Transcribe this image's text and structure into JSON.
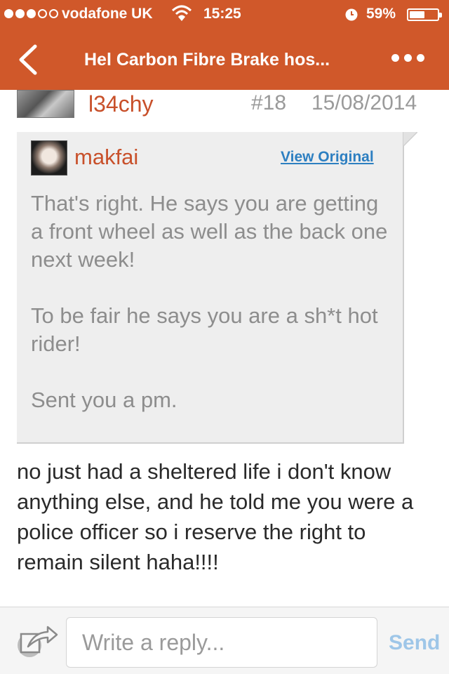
{
  "status_bar": {
    "carrier": "vodafone UK",
    "time": "15:25",
    "battery_percent": "59%",
    "battery_level": 0.59,
    "signal_bars_filled": 3,
    "signal_bars_total": 5,
    "icons": [
      "signal-dots-icon",
      "wifi-icon",
      "alarm-icon",
      "battery-icon"
    ]
  },
  "nav": {
    "title": "Hel Carbon Fibre Brake hos...",
    "back_icon": "chevron-left-icon",
    "more_icon": "more-dots-icon",
    "bar_color": "#d0582a"
  },
  "post": {
    "username": "l34chy",
    "post_number": "#18",
    "date": "15/08/2014",
    "quote": {
      "username": "makfai",
      "view_original_label": "View Original",
      "paragraphs": [
        "That's right.  He says you are getting a front wheel as well as the back one next week!",
        "To be fair he says you are a sh*t hot rider!",
        "Sent you a pm."
      ]
    },
    "body": "no just had a sheltered life i don't know anything else, and he told me you were a police officer so i reserve the right to remain silent haha!!!!"
  },
  "compose": {
    "placeholder": "Write a reply...",
    "value": "",
    "send_label": "Send",
    "icon": "share-reply-icon"
  },
  "colors": {
    "accent": "#d0582a",
    "username": "#c8502a",
    "link": "#2d7fc1",
    "send_disabled": "#9ec6e8"
  }
}
